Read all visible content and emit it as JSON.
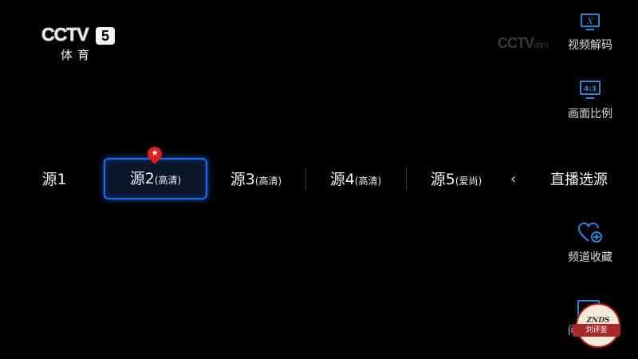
{
  "channel_logo": {
    "brand": "CCTV",
    "number": "5",
    "subtitle": "体育"
  },
  "watermark": {
    "brand": "CCTV",
    "suffix": "com"
  },
  "sources": [
    {
      "main": "源1",
      "quality": ""
    },
    {
      "main": "源2",
      "quality": "(高清)",
      "selected": true
    },
    {
      "main": "源3",
      "quality": "(高清)"
    },
    {
      "main": "源4",
      "quality": "(高清)"
    },
    {
      "main": "源5",
      "quality": "(爱尚)"
    }
  ],
  "right_panel": {
    "decode": {
      "label": "视频解码",
      "icon_text": "X"
    },
    "aspect": {
      "label": "画面比例",
      "icon_text": "4:3"
    },
    "source_title": "直播选源",
    "favorite": {
      "label": "频道收藏"
    },
    "partial_label": "问"
  },
  "badge": {
    "top": "ZNDS",
    "ribbon": "刘评鉴"
  },
  "colors": {
    "accent": "#1f6bff",
    "icon_blue": "#2a87d6",
    "pin_red": "#e21b1b"
  }
}
